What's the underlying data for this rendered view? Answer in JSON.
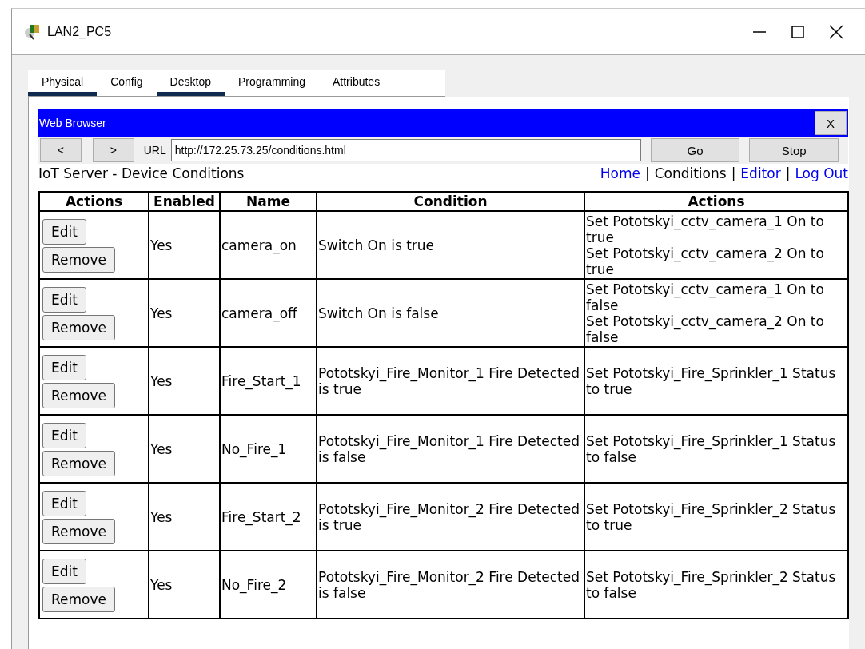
{
  "window": {
    "title": "LAN2_PC5"
  },
  "tabs": [
    {
      "label": "Physical",
      "selected": true
    },
    {
      "label": "Config",
      "selected": false
    },
    {
      "label": "Desktop",
      "selected": true
    },
    {
      "label": "Programming",
      "selected": false
    },
    {
      "label": "Attributes",
      "selected": false
    }
  ],
  "browser": {
    "title": "Web Browser",
    "close": "X",
    "back": "<",
    "forward": ">",
    "url_label": "URL",
    "url": "http://172.25.73.25/conditions.html",
    "go": "Go",
    "stop": "Stop"
  },
  "page": {
    "heading": "IoT Server - Device Conditions",
    "nav": [
      {
        "label": "Home",
        "selected": false
      },
      {
        "label": "Conditions",
        "selected": true
      },
      {
        "label": "Editor",
        "selected": false
      },
      {
        "label": "Log Out",
        "selected": false
      }
    ],
    "separator": "|"
  },
  "table": {
    "columns": [
      "Actions",
      "Enabled",
      "Name",
      "Condition",
      "Actions"
    ],
    "rows": [
      {
        "buttons": [
          "Edit",
          "Remove"
        ],
        "enabled": "Yes",
        "name": "camera_on",
        "condition": "Switch On is true",
        "actions": [
          "Set Pototskyi_cctv_camera_1 On to true",
          "Set Pototskyi_cctv_camera_2 On to true"
        ]
      },
      {
        "buttons": [
          "Edit",
          "Remove"
        ],
        "enabled": "Yes",
        "name": "camera_off",
        "condition": "Switch On is false",
        "actions": [
          "Set Pototskyi_cctv_camera_1 On to false",
          "Set Pototskyi_cctv_camera_2 On to false"
        ]
      },
      {
        "buttons": [
          "Edit",
          "Remove"
        ],
        "enabled": "Yes",
        "name": "Fire_Start_1",
        "condition": "Pototskyi_Fire_Monitor_1 Fire Detected is true",
        "actions": [
          "Set Pototskyi_Fire_Sprinkler_1 Status to true"
        ]
      },
      {
        "buttons": [
          "Edit",
          "Remove"
        ],
        "enabled": "Yes",
        "name": "No_Fire_1",
        "condition": "Pototskyi_Fire_Monitor_1 Fire Detected is false",
        "actions": [
          "Set Pototskyi_Fire_Sprinkler_1 Status to false"
        ]
      },
      {
        "buttons": [
          "Edit",
          "Remove"
        ],
        "enabled": "Yes",
        "name": "Fire_Start_2",
        "condition": "Pototskyi_Fire_Monitor_2 Fire Detected is true",
        "actions": [
          "Set Pototskyi_Fire_Sprinkler_2 Status to true"
        ]
      },
      {
        "buttons": [
          "Edit",
          "Remove"
        ],
        "enabled": "Yes",
        "name": "No_Fire_2",
        "condition": "Pototskyi_Fire_Monitor_2 Fire Detected is false",
        "actions": [
          "Set Pototskyi_Fire_Sprinkler_2 Status to false"
        ]
      }
    ]
  }
}
